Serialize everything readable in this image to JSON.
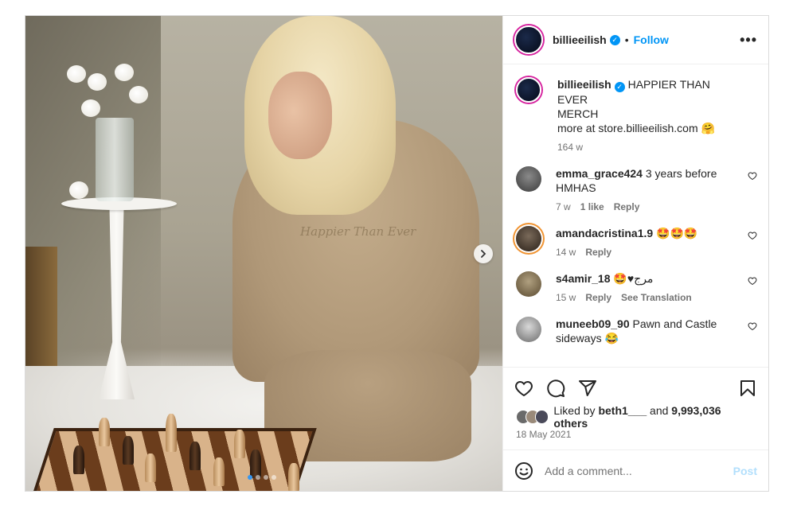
{
  "post": {
    "author": "billieeilish",
    "follow_label": "Follow",
    "separator": "•",
    "more_label": "•••"
  },
  "caption": {
    "username": "billieeilish",
    "line1": "HAPPIER THAN EVER",
    "line2": "MERCH",
    "line3": "more at store.billieeilish.com 🤗",
    "time": "164 w"
  },
  "photo": {
    "hoodie_text": "Happier Than Ever",
    "carousel_dots": 4,
    "active_dot": 1
  },
  "comments": [
    {
      "username": "emma_grace424",
      "text": "3 years before HMHAS",
      "time": "7 w",
      "likes": "1 like",
      "reply": "Reply"
    },
    {
      "username": "amandacristina1.9",
      "text": "🤩🤩🤩",
      "time": "14 w",
      "reply": "Reply"
    },
    {
      "username": "s4amir_18",
      "text": "🤩♥مرج",
      "time": "15 w",
      "reply": "Reply",
      "translate": "See Translation"
    },
    {
      "username": "muneeb09_90",
      "text": "Pawn and Castle sideways 😂",
      "time": "",
      "reply": ""
    }
  ],
  "likes": {
    "prefix": "Liked by",
    "user": "beth1___",
    "and": "and",
    "count": "9,993,036 others"
  },
  "date": "18 May 2021",
  "add_comment": {
    "placeholder": "Add a comment...",
    "post_label": "Post"
  },
  "colors": {
    "accent": "#0095f6",
    "post_disabled": "#b2dffc",
    "muted": "#737373"
  }
}
